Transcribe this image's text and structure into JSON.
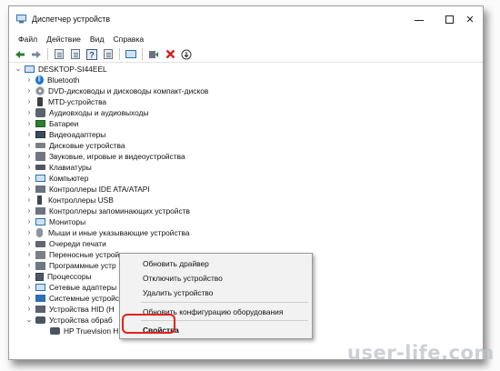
{
  "window": {
    "title": "Диспетчер устройств",
    "controls": {
      "minimize": "—",
      "maximize": "☐",
      "close": "✕"
    }
  },
  "menu": {
    "items": [
      "Файл",
      "Действие",
      "Вид",
      "Справка"
    ]
  },
  "toolbar": {
    "buttons": [
      "back-icon",
      "forward-icon",
      "properties-icon",
      "list-icon",
      "help-icon",
      "details-icon",
      "monitor-icon",
      "update-driver-icon",
      "remove-icon",
      "download-icon"
    ]
  },
  "tree": {
    "root": "DESKTOP-SI44EEL",
    "items": [
      "Bluetooth",
      "DVD-дисководы и дисководы компакт-дисков",
      "MTD-устройства",
      "Аудиовходы и аудиовыходы",
      "Батареи",
      "Видеоадаптеры",
      "Дисковые устройства",
      "Звуковые, игровые и видеоустройства",
      "Клавиатуры",
      "Компьютер",
      "Контроллеры IDE ATA/ATAPI",
      "Контроллеры USB",
      "Контроллеры запоминающих устройств",
      "Мониторы",
      "Мыши и иные указывающие устройства",
      "Очереди печати",
      "Переносные устрой",
      "Программные устр",
      "Процессоры",
      "Сетевые адаптеры",
      "Системные устройс",
      "Устройства HID (H",
      "Устройства обраб"
    ],
    "selected_child": "HP Truevision HD"
  },
  "context_menu": {
    "items": [
      "Обновить драйвер",
      "Отключить устройство",
      "Удалить устройство",
      "Обновить конфигурацию оборудования",
      "Свойства"
    ],
    "highlight_color": "#e0221c"
  },
  "watermark": "user-life.com"
}
